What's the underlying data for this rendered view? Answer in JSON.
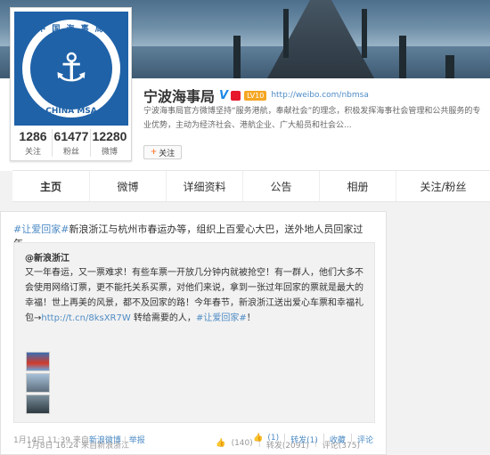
{
  "profile": {
    "name": "宁波海事局",
    "url": "http://weibo.com/nbmsa",
    "intro": "宁波海事局官方微博坚持“服务港航，奉献社会”的理念，积极发挥海事社会管理和公共服务的专业优势，主动为经济社会、港航企业、广大船员和社会公...",
    "follow_label": "关注",
    "level_label": "LV10",
    "avatar": {
      "ring_top": "中 国 海 事 局",
      "ring_bottom": "CHINA MSA"
    },
    "stats": [
      {
        "num": "1286",
        "label": "关注"
      },
      {
        "num": "61477",
        "label": "粉丝"
      },
      {
        "num": "12280",
        "label": "微博"
      }
    ]
  },
  "nav": {
    "items": [
      "主页",
      "微博",
      "详细资料",
      "公告",
      "相册",
      "关注/粉丝"
    ]
  },
  "post": {
    "topic": "#让爱回家#",
    "text": "新浪浙江与杭州市春运办等，组织上百爱心大巴，送外地人员回家过年。",
    "time": "1月14日 11:39",
    "from_prefix": "来自",
    "source": "新浪微博",
    "report": "举报",
    "actions": [
      "(1)",
      "转发(1)",
      "收藏",
      "评论"
    ]
  },
  "repost": {
    "author": "@新浪浙江",
    "text_before_link": "又一年春运，又一票难求！有些车票一开放几分钟内就被抢空！有一群人，他们大多不会使用网络订票，更不能托关系买票，对他们来说，拿到一张过年回家的票就是最大的幸福！世上再美的风景，都不及回家的路！今年春节，新浪浙江送出爱心车票和幸福礼包→",
    "link": "http://t.cn/8ksXR7W",
    "text_after_link": " 转给需要的人，",
    "topic_end": "#让爱回家#",
    "text_end": "！",
    "time": "1月8日 16:24",
    "from_prefix": "来自",
    "source": "新浪浙江",
    "actions": [
      "(140)",
      "转发(2091)",
      "评论(375)"
    ]
  },
  "colors": {
    "link": "#4f8cc5",
    "accent": "#ff8140",
    "v_badge": "#1e88e5"
  }
}
